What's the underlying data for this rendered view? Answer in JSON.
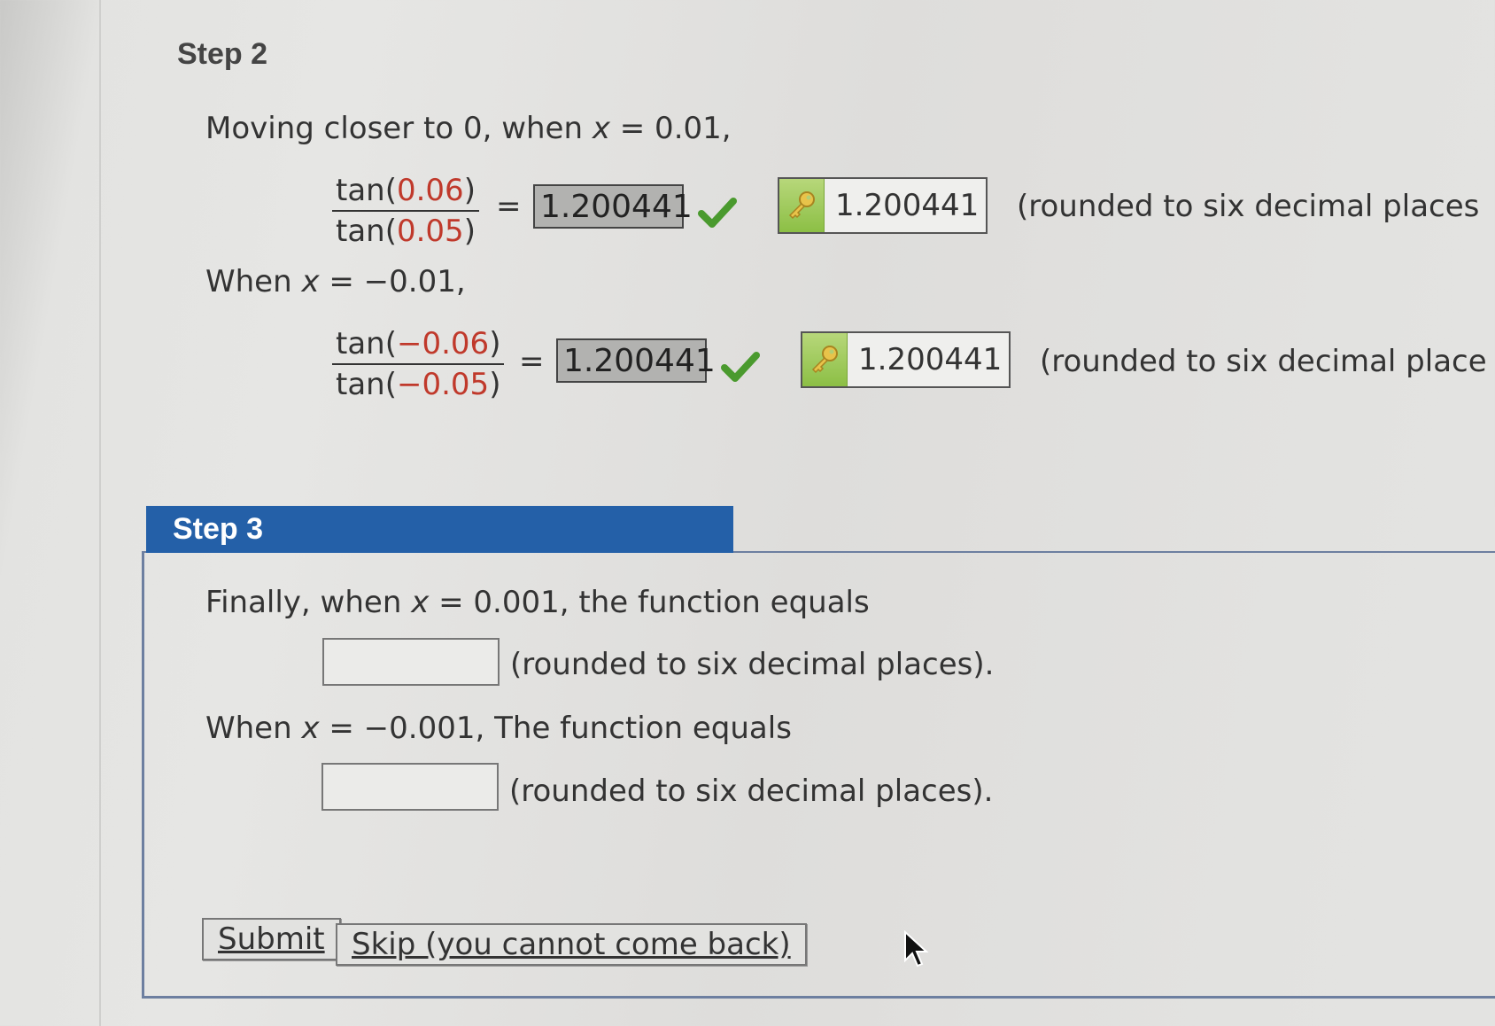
{
  "step2": {
    "heading": "Step 2",
    "intro_prefix": "Moving closer to 0, when ",
    "intro_var": "x",
    "intro_suffix": " = 0.01,",
    "eq1": {
      "num_prefix": "tan(",
      "num_value": "0.06",
      "num_suffix": ")",
      "den_prefix": "tan(",
      "den_value": "0.05",
      "den_suffix": ")",
      "equals": "=",
      "answer": "1.200441",
      "key_answer": "1.200441",
      "note": "(rounded to six decimal places"
    },
    "when_prefix": "When ",
    "when_var": "x",
    "when_suffix": " = −0.01,",
    "eq2": {
      "num_prefix": "tan(",
      "num_value": "−0.06",
      "num_suffix": ")",
      "den_prefix": "tan(",
      "den_value": "−0.05",
      "den_suffix": ")",
      "equals": "=",
      "answer": "1.200441",
      "key_answer": "1.200441",
      "note": "(rounded to six decimal place"
    }
  },
  "step3": {
    "heading": "Step 3",
    "line1_prefix": "Finally, when ",
    "line1_var": "x",
    "line1_suffix": " = 0.001, the function equals",
    "input1_value": "",
    "note1": "(rounded to six decimal places).",
    "line2_prefix": "When ",
    "line2_var": "x",
    "line2_suffix": " = −0.001, The function equals",
    "input2_value": "",
    "note2": "(rounded to six decimal places).",
    "submit_label": "Submit",
    "skip_label": "Skip (you cannot come back)"
  },
  "icons": {
    "check": "checkmark-icon",
    "key": "key-icon",
    "cursor": "mouse-cursor-icon"
  },
  "colors": {
    "tab_blue": "#2460a8",
    "check_green": "#4a9a2e",
    "key_green": "#8cbf45",
    "red_number": "#c0392b"
  }
}
